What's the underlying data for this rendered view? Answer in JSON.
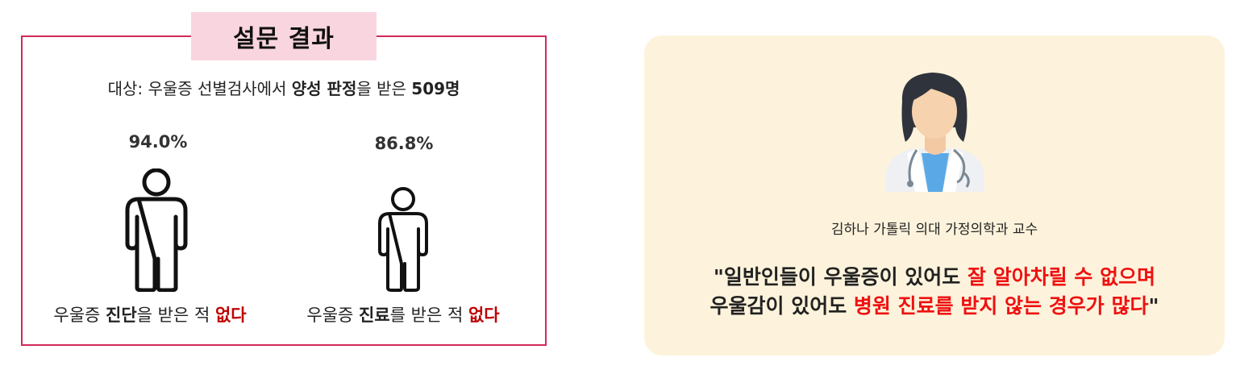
{
  "survey": {
    "title": "설문 결과",
    "subject_prefix": "대상: 우울증 선별검사에서 ",
    "subject_bold1": "양성 판정",
    "subject_mid": "을 받은 ",
    "subject_bold2": "509명",
    "stats": [
      {
        "value": "94.0%",
        "label_a": "우울증 ",
        "label_b": "진단",
        "label_c": "을 받은 적 ",
        "label_d": "없다"
      },
      {
        "value": "86.8%",
        "label_a": "우울증 ",
        "label_b": "진료",
        "label_c": "를 받은 적 ",
        "label_d": "없다"
      }
    ]
  },
  "quote_panel": {
    "name": "김하나 가톨릭 의대 가정의학과 교수",
    "line1_a": "\"일반인들이 우울증이 있어도 ",
    "line1_b": "잘 알아차릴 수 없으며",
    "line2_a": "우울감이 있어도 ",
    "line2_b": "병원 진료를 받지 않는 경우가 많다",
    "line2_c": "\""
  },
  "colors": {
    "border": "#d22a5a",
    "title_bg": "#f9d6df",
    "negative": "#c00000",
    "panel_bg": "#fdf3dc",
    "quote_highlight": "#ee1111"
  }
}
